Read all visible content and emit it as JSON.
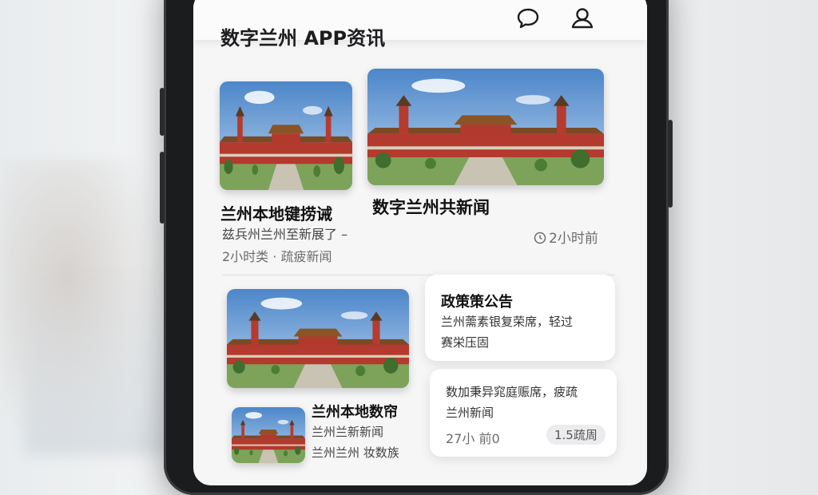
{
  "app": {
    "title": "数字兰州 APP资讯"
  },
  "header": {
    "icons": [
      "chat-bubble-icon",
      "user-profile-icon"
    ]
  },
  "feed": {
    "item1": {
      "title": "兰州本地键捞诫",
      "snippet": "兹兵州兰州至新展了 –",
      "meta": "2小时类 · 疏疲新闻"
    },
    "item2": {
      "title": "数字兰州共新闻",
      "meta": "2小时前"
    },
    "item3": {
      "title": "兰州本地数帘",
      "snippet": "兰州兰新新闻",
      "snippet2": "兰州兰州 妆数族"
    },
    "card1": {
      "title": "政策策公告",
      "line1": "兰州薷素银复荣席，轻过",
      "line2": "赛栄压固"
    },
    "card2": {
      "line1": "数加秉异窕庭赈席，疲疏",
      "line2": "兰州新闻",
      "meta": "27小 前0",
      "badge": "1.5疏周"
    }
  },
  "colors": {
    "accent": "#1d1d1f",
    "bezel": "#1b1c1e",
    "screen": "#f6f6f7"
  }
}
